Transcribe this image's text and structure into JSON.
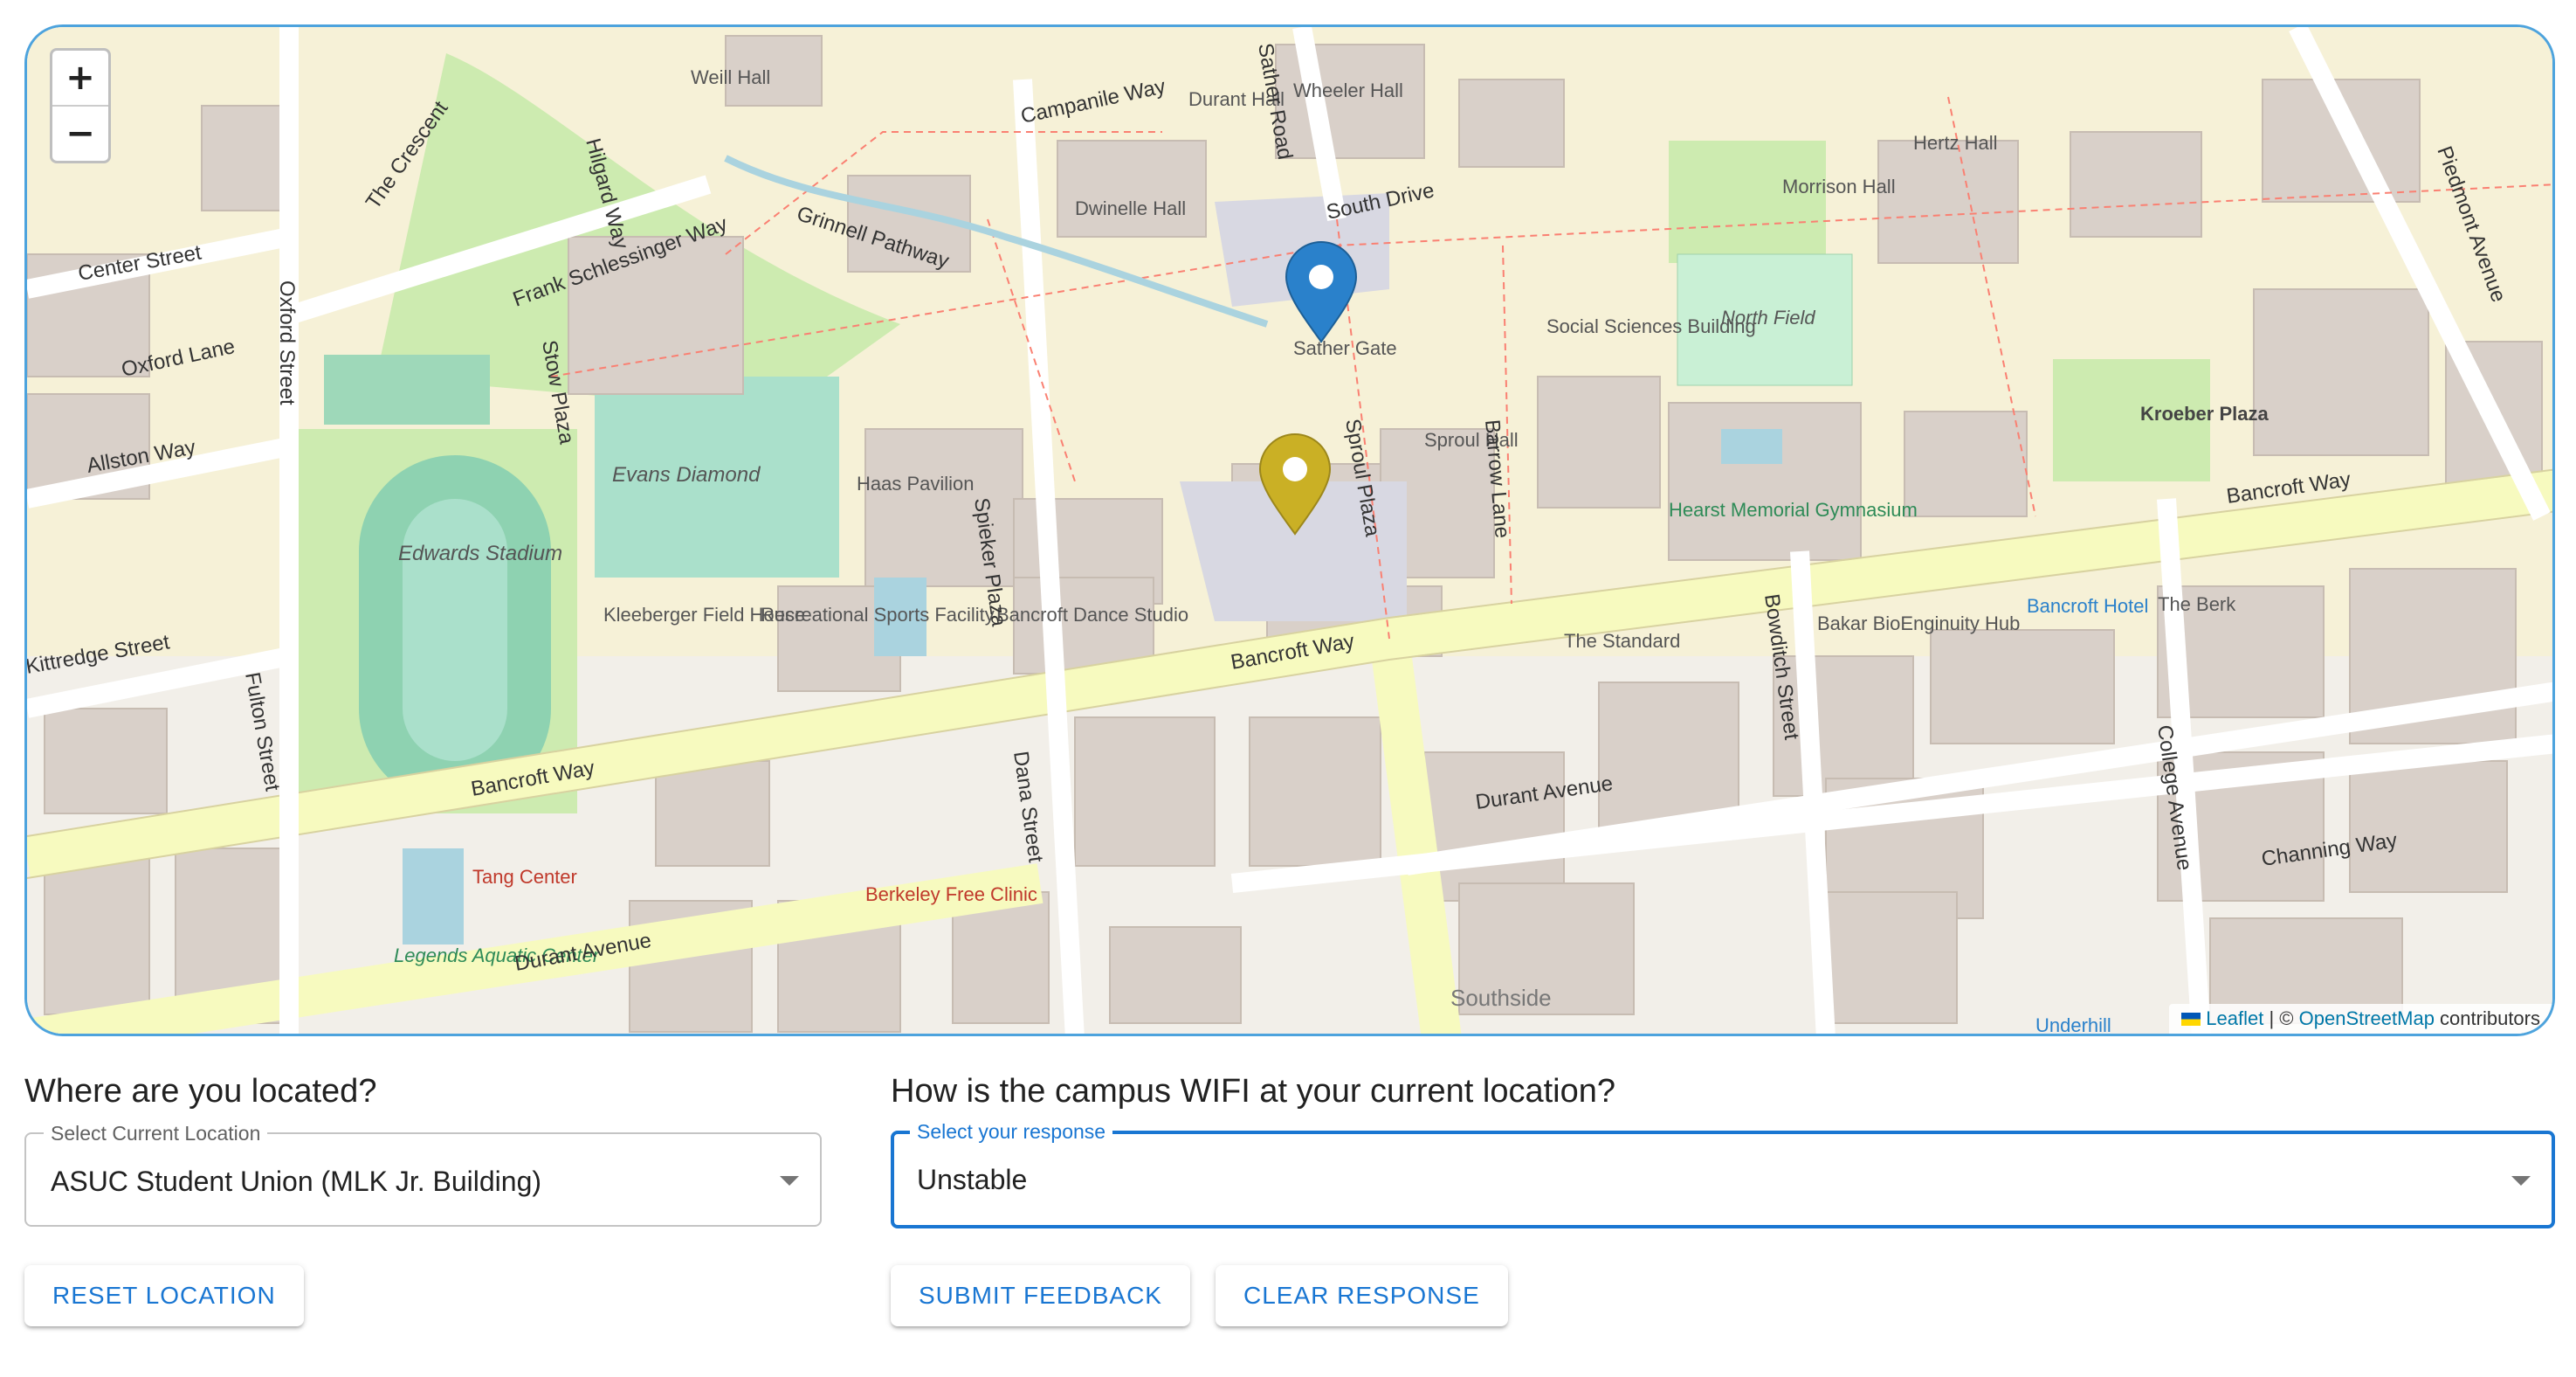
{
  "map": {
    "zoom_in": "+",
    "zoom_out": "−",
    "attribution": {
      "leaflet": "Leaflet",
      "separator": " | © ",
      "osm": "OpenStreetMap",
      "suffix": " contributors"
    },
    "streets": {
      "campanile_way": "Campanile Way",
      "south_drive": "South Drive",
      "center_street": "Center Street",
      "oxford_lane": "Oxford Lane",
      "allston_way": "Allston Way",
      "oxford_street": "Oxford Street",
      "kittredge_street": "Kittredge Street",
      "fulton_street": "Fulton Street",
      "bancroft_way": "Bancroft Way",
      "durant_avenue": "Durant Avenue",
      "channing_way": "Channing Way",
      "dana_street": "Dana Street",
      "bowditch_street": "Bowditch Street",
      "college_avenue": "College Avenue",
      "piedmont_avenue": "Piedmont Avenue",
      "sproul_plaza": "Sproul Plaza",
      "spieker_plaza": "Spieker Plaza",
      "barrow_lane": "Barrow Lane",
      "frank_schlessinger_way": "Frank Schlessinger Way",
      "grinnell_pathway": "Grinnell Pathway",
      "the_crescent": "The Crescent",
      "stow_plaza": "Stow Plaza",
      "hilgard_way": "Hilgard Way",
      "sather_road": "Sather Road"
    },
    "places": {
      "edwards_stadium": "Edwards Stadium",
      "evans_diamond": "Evans Diamond",
      "haas_pavilion": "Haas Pavilion",
      "north_field": "North Field",
      "sather_gate": "Sather Gate",
      "the_standard": "The Standard",
      "bakar": "Bakar BioEnginuity Hub",
      "weill_hall": "Weill Hall",
      "wheeler_hall": "Wheeler Hall",
      "dwinelle_hall": "Dwinelle Hall",
      "durant_hall": "Durant Hall",
      "morrison_hall": "Morrison Hall",
      "hertz_hall": "Hertz Hall",
      "sproul_hall": "Sproul Hall",
      "tang_center": "Tang Center",
      "berkeley_free_clinic": "Berkeley Free Clinic",
      "kroeber_plaza": "Kroeber Plaza",
      "recreational_sports": "Recreational Sports Facility",
      "bancroft_hotel": "Bancroft Hotel",
      "the_berk": "The Berk",
      "southside": "Southside",
      "bancroft_dance": "Bancroft Dance Studio",
      "social_sciences": "Social Sciences Building",
      "hearst_gym": "Hearst Memorial Gymnasium",
      "underhill": "Underhill",
      "legends_aquatic": "Legends Aquatic Center",
      "kleeberger": "Kleeberger Field House"
    },
    "markers": [
      "blue-pin",
      "gold-pin"
    ],
    "colors": {
      "border": "#4da3dd",
      "blue_pin": "#2a81cb",
      "gold_pin": "#cab025"
    }
  },
  "location": {
    "question": "Where are you located?",
    "label": "Select Current Location",
    "value": "ASUC Student Union (MLK Jr. Building)",
    "reset_label": "Reset Location"
  },
  "wifi": {
    "question": "How is the campus WIFI at your current location?",
    "label": "Select your response",
    "value": "Unstable",
    "submit_label": "Submit Feedback",
    "clear_label": "Clear Response"
  },
  "colors": {
    "primary": "#1976d2",
    "text": "#212121"
  }
}
